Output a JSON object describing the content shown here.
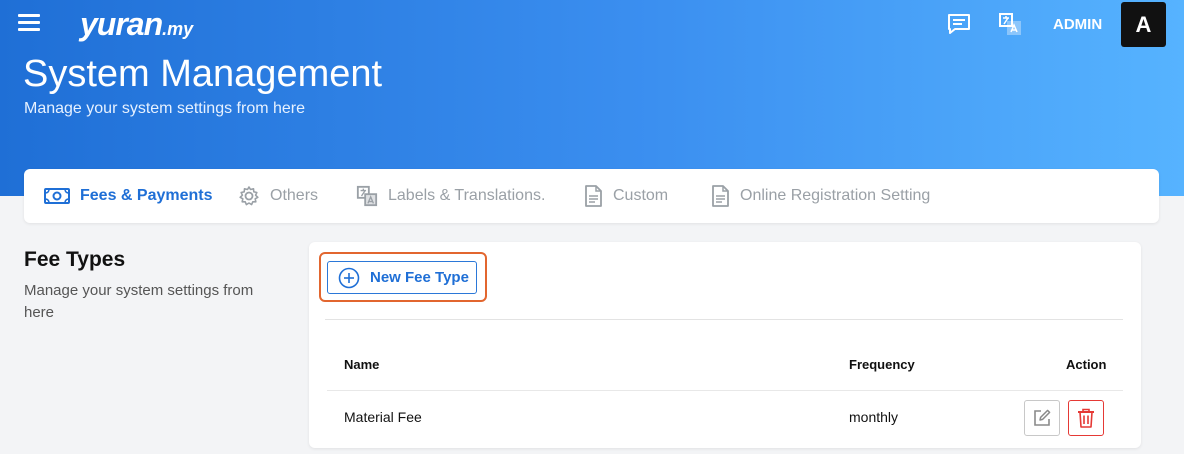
{
  "header": {
    "logo_main": "yuran",
    "logo_sub": ".my",
    "user_label": "ADMIN",
    "avatar_initial": "A",
    "icons": [
      "menu-icon",
      "chat-icon",
      "translate-icon"
    ]
  },
  "page": {
    "title": "System Management",
    "subtitle": "Manage your system settings from here"
  },
  "tabs": [
    {
      "label": "Fees & Payments",
      "icon": "money-icon",
      "active": true
    },
    {
      "label": "Others",
      "icon": "gear-icon",
      "active": false
    },
    {
      "label": "Labels & Translations.",
      "icon": "translate-icon",
      "active": false
    },
    {
      "label": "Custom",
      "icon": "document-icon",
      "active": false
    },
    {
      "label": "Online Registration Setting",
      "icon": "document-icon",
      "active": false
    }
  ],
  "section": {
    "title": "Fee Types",
    "description": "Manage your system settings from here"
  },
  "card": {
    "new_button_label": "New Fee Type",
    "columns": [
      "Name",
      "Frequency",
      "Action"
    ],
    "rows": [
      {
        "name": "Material Fee",
        "frequency": "monthly"
      }
    ]
  },
  "colors": {
    "primary": "#1f6fd6",
    "highlight_border": "#e2662f",
    "delete": "#e53935"
  }
}
